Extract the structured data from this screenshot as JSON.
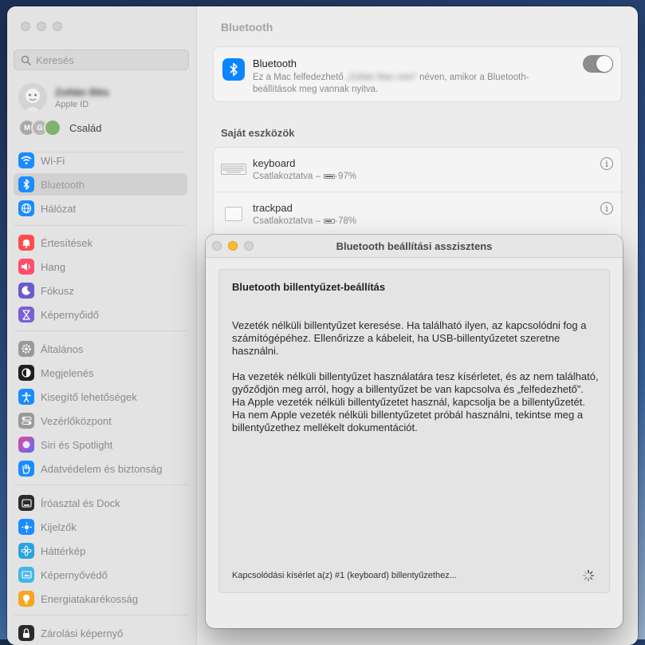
{
  "sidebar": {
    "search_placeholder": "Keresés",
    "profile": {
      "name": "Zoltán Illés",
      "subtitle": "Apple ID"
    },
    "family": {
      "label": "Család",
      "initials": [
        "M",
        "G"
      ]
    },
    "items": [
      {
        "label": "Wi-Fi",
        "icon": "wifi-icon",
        "color": "#1a8cff"
      },
      {
        "label": "Bluetooth",
        "icon": "bluetooth-icon",
        "color": "#1a8cff",
        "selected": true
      },
      {
        "label": "Hálózat",
        "icon": "globe-icon",
        "color": "#1a8cff"
      },
      {
        "label": "Értesítések",
        "icon": "bell-icon",
        "color": "#ff4d4d"
      },
      {
        "label": "Hang",
        "icon": "speaker-icon",
        "color": "#ff4d6d"
      },
      {
        "label": "Fókusz",
        "icon": "moon-icon",
        "color": "#6a5acd"
      },
      {
        "label": "Képernyőidő",
        "icon": "hourglass-icon",
        "color": "#7b5fd6"
      },
      {
        "label": "Általános",
        "icon": "gear-icon",
        "color": "#9a9a9a"
      },
      {
        "label": "Megjelenés",
        "icon": "appearance-icon",
        "color": "#1f1f1f"
      },
      {
        "label": "Kisegítő lehetőségek",
        "icon": "accessibility-icon",
        "color": "#1a8cff"
      },
      {
        "label": "Vezérlőközpont",
        "icon": "control-center-icon",
        "color": "#9a9a9a"
      },
      {
        "label": "Siri és Spotlight",
        "icon": "siri-icon",
        "color": "#9b59d0"
      },
      {
        "label": "Adatvédelem és biztonság",
        "icon": "hand-icon",
        "color": "#1a8cff"
      },
      {
        "label": "Íróasztal és Dock",
        "icon": "dock-icon",
        "color": "#2b2b2b"
      },
      {
        "label": "Kijelzők",
        "icon": "display-icon",
        "color": "#1a8cff"
      },
      {
        "label": "Háttérkép",
        "icon": "wallpaper-icon",
        "color": "#29a3e0"
      },
      {
        "label": "Képernyővédő",
        "icon": "screensaver-icon",
        "color": "#45b6e8"
      },
      {
        "label": "Energiatakarékosság",
        "icon": "bulb-icon",
        "color": "#f5a623"
      },
      {
        "label": "Zárolási képernyő",
        "icon": "lock-icon",
        "color": "#2b2b2b"
      }
    ]
  },
  "content": {
    "title": "Bluetooth",
    "bluetooth": {
      "title": "Bluetooth",
      "desc_prefix": "Ez a Mac felfedezhető",
      "desc_name": "„Zoltán Mac mini”",
      "desc_suffix": "néven, amikor a Bluetooth-beállítások meg vannak nyitva.",
      "enabled": true
    },
    "devices_title": "Saját eszközök",
    "devices": [
      {
        "name": "keyboard",
        "status": "Csatlakoztatva –",
        "battery": "97%",
        "battery_level": 0.97
      },
      {
        "name": "trackpad",
        "status": "Csatlakoztatva –",
        "battery": "78%",
        "battery_level": 0.78
      }
    ]
  },
  "dialog": {
    "title": "Bluetooth beállítási asszisztens",
    "heading": "Bluetooth billentyűzet-beállítás",
    "para1": "Vezeték nélküli billentyűzet keresése. Ha található ilyen, az kapcsolódni fog a számítógépéhez. Ellenőrizze a kábeleit, ha USB-billentyűzetet szeretne használni.",
    "para2": "Ha vezeték nélküli billentyűzet használatára tesz kísérletet, és az nem található, győződjön meg arról, hogy a billentyűzet be van kapcsolva és „felfedezhető”. Ha Apple vezeték nélküli billentyűzetet használ, kapcsolja be a billentyűzetét. Ha nem Apple vezeték nélküli billentyűzetet próbál használni, tekintse meg a billentyűzethez mellékelt dokumentációt.",
    "status": "Kapcsolódási kísérlet a(z) #1 (keyboard) billentyűzethez..."
  }
}
